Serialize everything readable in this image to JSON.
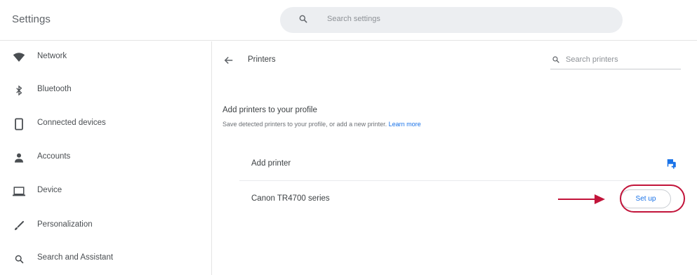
{
  "header": {
    "title": "Settings",
    "search_placeholder": "Search settings"
  },
  "sidebar": {
    "items": [
      {
        "label": "Network",
        "icon": "wifi-icon"
      },
      {
        "label": "Bluetooth",
        "icon": "bluetooth-icon"
      },
      {
        "label": "Connected devices",
        "icon": "phone-icon"
      },
      {
        "label": "Accounts",
        "icon": "person-icon"
      },
      {
        "label": "Device",
        "icon": "laptop-icon"
      },
      {
        "label": "Personalization",
        "icon": "brush-icon"
      },
      {
        "label": "Search and Assistant",
        "icon": "search-icon"
      }
    ]
  },
  "main": {
    "page_title": "Printers",
    "search_placeholder": "Search printers",
    "section": {
      "title": "Add printers to your profile",
      "description": "Save detected printers to your profile, or add a new printer.",
      "link": "Learn more"
    },
    "rows": [
      {
        "label": "Add printer"
      },
      {
        "label": "Canon TR4700 series",
        "action": "Set up"
      }
    ]
  },
  "colors": {
    "accent": "#1a73e8",
    "annotation": "#c2143a",
    "search_bg": "#eceef1"
  }
}
